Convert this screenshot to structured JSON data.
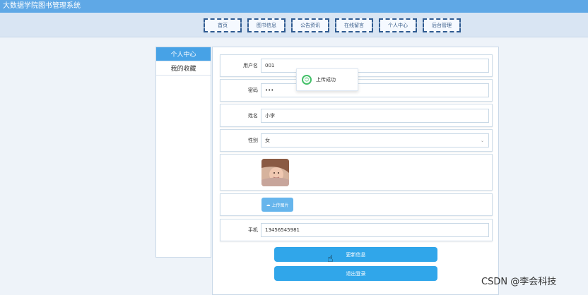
{
  "app": {
    "title": "大数据学院图书管理系统"
  },
  "nav": {
    "items": [
      "首页",
      "图书信息",
      "公告资讯",
      "在线留言",
      "个人中心",
      "后台管理"
    ]
  },
  "sidebar": {
    "items": [
      "个人中心",
      "我的收藏"
    ]
  },
  "form": {
    "username_label": "用户名",
    "username_value": "001",
    "password_label": "密码",
    "password_value": "•••",
    "name_label": "姓名",
    "name_value": "小李",
    "gender_label": "性别",
    "gender_value": "女",
    "upload_label": "上传图片",
    "phone_label": "手机",
    "phone_value": "13456545981"
  },
  "buttons": {
    "update": "更新信息",
    "logout": "退出登录"
  },
  "toast": {
    "message": "上传成功"
  },
  "watermark": "CSDN @李会科技",
  "colors": {
    "accent": "#47a2e6",
    "topbar": "#5fa8e6",
    "button": "#30a6ea",
    "success": "#43c068"
  }
}
